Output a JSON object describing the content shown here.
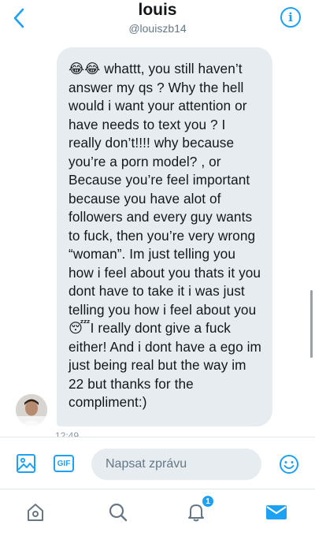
{
  "header": {
    "name": "louis",
    "handle": "@louiszb14"
  },
  "message": {
    "emoji_prefix": "😂😂",
    "text_part1": " whattt, you still haven’t answer my qs ? Why the hell would i want your attention or have needs to text you ? I really don’t!!!! why because you’re a porn model? , or Because you’re feel important because you have alot of followers and every guy wants to fuck, then you’re  very wrong “woman”. Im just telling you how i feel about you thats it you dont have to take it i was just telling you how i feel about you",
    "emoji_mid": "😴",
    "text_part2": "I really dont give a fuck either! And i dont have a ego im just being real but the way im 22 but thanks for the compliment:)",
    "timestamp": "12:49"
  },
  "composer": {
    "gif_label": "GIF",
    "placeholder": "Napsat zprávu"
  },
  "tabbar": {
    "notification_count": "1"
  },
  "icons": {
    "back": "chevron-left-icon",
    "info": "info-icon",
    "image": "image-icon",
    "gif": "gif-icon",
    "emoji": "emoji-icon",
    "home": "home-icon",
    "search": "search-icon",
    "notifications": "bell-icon",
    "messages": "mail-icon"
  },
  "colors": {
    "accent": "#1da1f2",
    "bubble": "#e6ecf0",
    "text": "#14171a",
    "secondary_text": "#657786"
  }
}
